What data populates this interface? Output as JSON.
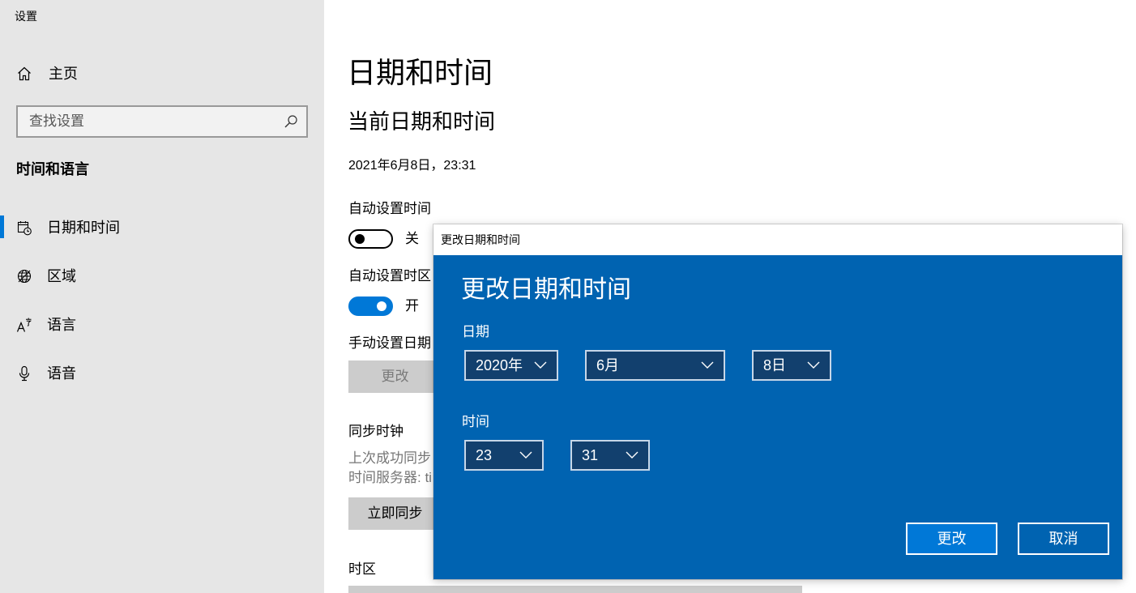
{
  "window": {
    "title": "设置"
  },
  "colors": {
    "accent": "#0078d7",
    "dialog_background": "#0063b1",
    "dialog_primary_button": "#0078d7",
    "dropdown_background": "#12406e",
    "sidebar_background": "#e6e6e6"
  },
  "sidebar": {
    "home": {
      "label": "主页",
      "icon": "home-icon"
    },
    "search": {
      "placeholder": "查找设置",
      "icon": "search-icon"
    },
    "section_title": "时间和语言",
    "items": [
      {
        "label": "日期和时间",
        "icon": "calendar-clock-icon",
        "selected": true
      },
      {
        "label": "区域",
        "icon": "globe-icon",
        "selected": false
      },
      {
        "label": "语言",
        "icon": "language-icon",
        "selected": false
      },
      {
        "label": "语音",
        "icon": "microphone-icon",
        "selected": false
      }
    ]
  },
  "main": {
    "page_title": "日期和时间",
    "current_heading": "当前日期和时间",
    "current_value": "2021年6月8日，23:31",
    "auto_time": {
      "label": "自动设置时间",
      "state_label": "关",
      "on": false
    },
    "auto_timezone": {
      "label": "自动设置时区",
      "state_label": "开",
      "on": true
    },
    "manual": {
      "label": "手动设置日期",
      "button_label": "更改"
    },
    "sync": {
      "heading": "同步时钟",
      "last_sync": "上次成功同步",
      "server": "时间服务器: ti",
      "button_label": "立即同步"
    },
    "timezone": {
      "heading": "时区"
    }
  },
  "dialog": {
    "window_title": "更改日期和时间",
    "title": "更改日期和时间",
    "date_label": "日期",
    "year": "2020年",
    "month": "6月",
    "day": "8日",
    "time_label": "时间",
    "hour": "23",
    "minute": "31",
    "ok_label": "更改",
    "cancel_label": "取消"
  }
}
